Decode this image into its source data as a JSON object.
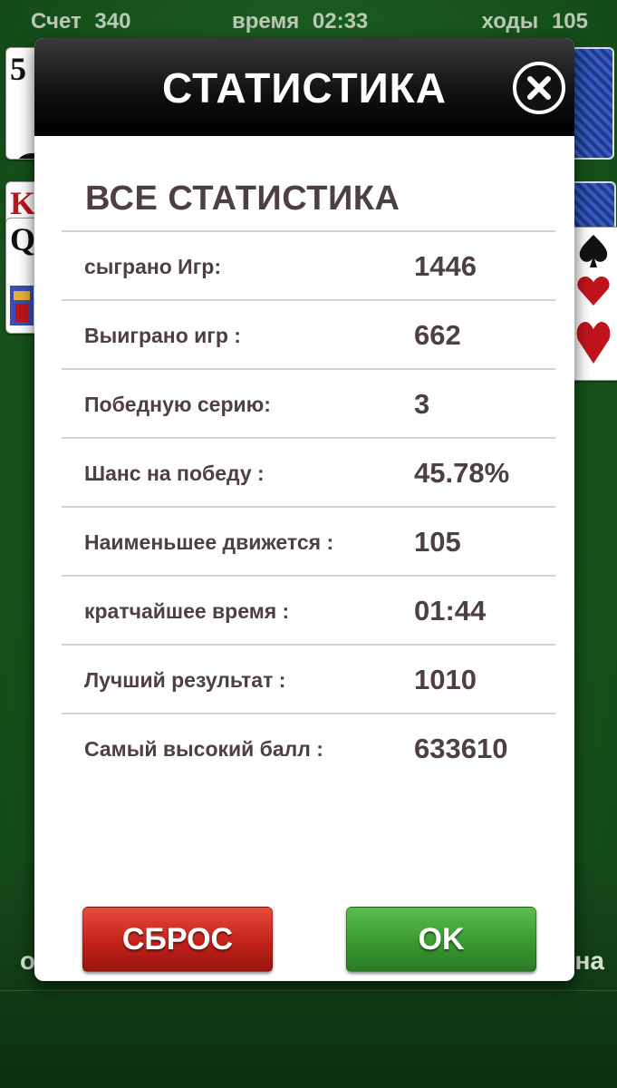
{
  "status": {
    "score_label": "Счет",
    "score_value": "340",
    "time_label": "время",
    "time_value": "02:33",
    "moves_label": "ходы",
    "moves_value": "105"
  },
  "background": {
    "cards": [
      {
        "rank": "5",
        "suit": "clubs"
      },
      {
        "rank": "K",
        "suit": "hearts"
      },
      {
        "rank": "Q",
        "suit": "spades"
      }
    ],
    "bottom_left_text": "о",
    "bottom_right_text": "на"
  },
  "modal": {
    "title": "СТАТИСТИКА",
    "section_title": "ВСЕ СТАТИСТИКА",
    "stats": [
      {
        "label": "сыграно Игр:",
        "value": "1446"
      },
      {
        "label": "Выиграно игр :",
        "value": "662"
      },
      {
        "label": "Победную серию:",
        "value": "3"
      },
      {
        "label": "Шанс на победу :",
        "value": "45.78%"
      },
      {
        "label": "Наименьшее движется :",
        "value": "105"
      },
      {
        "label": "кратчайшее время :",
        "value": "01:44"
      },
      {
        "label": "Лучший результат :",
        "value": "1010"
      },
      {
        "label": "Самый высокий балл :",
        "value": "633610"
      }
    ],
    "reset_label": "СБРОС",
    "ok_label": "OK"
  },
  "colors": {
    "table_green": "#195a1f",
    "text_dark": "#4d3f44",
    "reset_red": "#c1231a",
    "ok_green": "#3a9a31"
  }
}
